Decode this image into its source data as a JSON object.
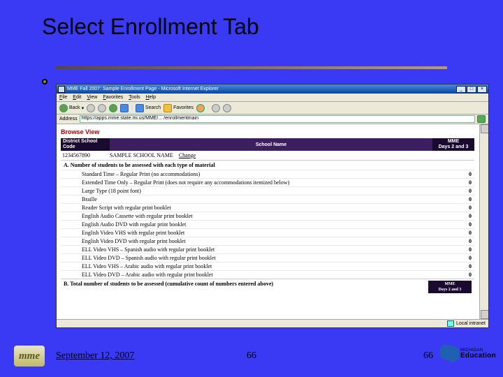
{
  "slide": {
    "title": "Select Enrollment Tab",
    "date": "September 12, 2007",
    "page_center": "66",
    "page_right": "66",
    "mme_logo": "mme",
    "mi_logo_top": "MICHIGAN",
    "mi_logo_bottom": "Education"
  },
  "browser": {
    "title": "MME Fall 2007: Sample Enrollment Page - Microsoft Internet Explorer",
    "menu": [
      "File",
      "Edit",
      "View",
      "Favorites",
      "Tools",
      "Help"
    ],
    "toolbar": {
      "back": "Back",
      "search": "Search",
      "favs_btn": "Favorites"
    },
    "address_label": "Address",
    "address_value": "https://apps.mme.state.mi.us/MME/... /enrollmentmain",
    "status_text": "Local intranet"
  },
  "page": {
    "browse_view": "Browse View",
    "hdr_left": "District School Code",
    "hdr_mid": "School Name",
    "hdr_right_top": "MME",
    "hdr_right_bottom": "Days 2 and 3",
    "school_code": "1234567890",
    "school_name": "SAMPLE SCHOOL NAME",
    "school_action": "Change",
    "section_a": "A. Number of students to be assessed with each type of material",
    "materials": [
      {
        "label": "Standard Time – Regular Print (no accommodations)",
        "val": "0"
      },
      {
        "label": "Extended Time Only – Regular Print (does not require any accommodations itemized below)",
        "val": "0"
      },
      {
        "label": "Large Type (18 point font)",
        "val": "0"
      },
      {
        "label": "Braille",
        "val": "0"
      },
      {
        "label": "Reader Script with regular print booklet",
        "val": "0"
      },
      {
        "label": "English Audio Cassette with regular print booklet",
        "val": "0"
      },
      {
        "label": "English Audio DVD with regular print booklet",
        "val": "0"
      },
      {
        "label": "English Video VHS with regular print booklet",
        "val": "0"
      },
      {
        "label": "English Video DVD with regular print booklet",
        "val": "0"
      },
      {
        "label": "ELL Video VHS – Spanish audio with regular print booklet",
        "val": "0"
      },
      {
        "label": "ELL Video DVD – Spanish audio with regular print booklet",
        "val": "0"
      },
      {
        "label": "ELL Video VHS – Arabic audio with regular print booklet",
        "val": "0"
      },
      {
        "label": "ELL Video DVD – Arabic audio with regular print booklet",
        "val": "0"
      }
    ],
    "section_b": "B. Total number of students to be assessed (cumulative count of numbers entered above)",
    "section_b_right_top": "MME",
    "section_b_right_bottom": "Days 2 and 3"
  }
}
